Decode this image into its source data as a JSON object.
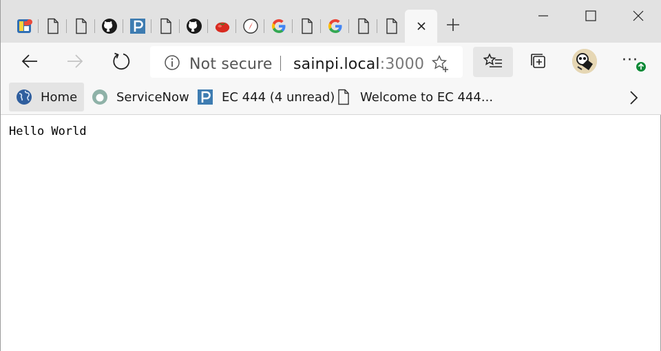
{
  "tabs": [
    {
      "icon": "collage-app-icon"
    },
    {
      "icon": "page-icon"
    },
    {
      "icon": "page-icon"
    },
    {
      "icon": "github-icon"
    },
    {
      "icon": "piazza-icon"
    },
    {
      "icon": "page-icon"
    },
    {
      "icon": "github-icon"
    },
    {
      "icon": "tomato-icon"
    },
    {
      "icon": "compass-icon"
    },
    {
      "icon": "google-icon"
    },
    {
      "icon": "page-icon"
    },
    {
      "icon": "google-icon"
    },
    {
      "icon": "page-icon"
    },
    {
      "icon": "page-icon"
    },
    {
      "icon": "close-icon",
      "active": true
    }
  ],
  "toolbar": {
    "security_label": "Not secure",
    "url_host": "sainpi.local",
    "url_port": ":3000"
  },
  "favorites": [
    {
      "label": "Home",
      "icon": "globe-icon"
    },
    {
      "label": "ServiceNow",
      "icon": "servicenow-icon"
    },
    {
      "label": "EC 444 (4 unread)",
      "icon": "piazza-icon"
    },
    {
      "label": "Welcome to EC 444...",
      "icon": "page-icon"
    }
  ],
  "page": {
    "body_text": "Hello World"
  },
  "colors": {
    "tabstrip_bg": "#e2e2e2",
    "toolbar_bg": "#f7f7f7",
    "update_badge": "#0f8a38",
    "piazza_blue": "#3e7cb1"
  }
}
